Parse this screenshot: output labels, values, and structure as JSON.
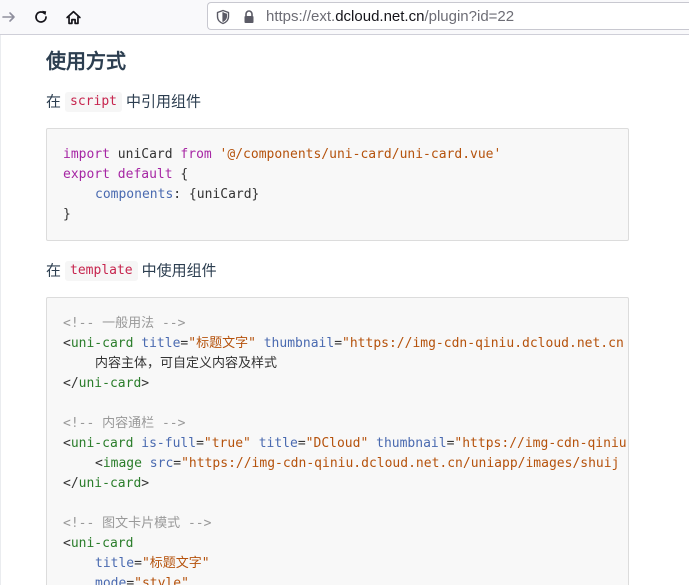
{
  "browser": {
    "url_scheme": "https://ext.",
    "url_host": "dcloud.net.cn",
    "url_path": "/plugin?id=22",
    "icons": [
      "arrow-right-icon",
      "reload-icon",
      "home-icon",
      "shield-icon",
      "lock-icon"
    ]
  },
  "page": {
    "section_title": "使用方式",
    "para1": {
      "prefix": "在",
      "code": "script",
      "suffix": "中引用组件"
    },
    "para2": {
      "prefix": "在",
      "code": "template",
      "suffix": "中使用组件"
    },
    "code1": {
      "l1_kw": "import",
      "l1_name": " uniCard ",
      "l1_from": "from",
      "l1_str": " '@/components/uni-card/uni-card.vue'",
      "l2_kw": "export",
      "l2_default": " default",
      "l2_brace": " {",
      "l3_prop": "components",
      "l3_rest": ": {uniCard}",
      "l4": "}"
    },
    "code2": {
      "c1": "<!-- 一般用法 -->",
      "l2_lt": "<",
      "l2_tag": "uni-card",
      "l2_a1": " title",
      "l2_eq1": "=",
      "l2_v1": "\"标题文字\"",
      "l2_a2": " thumbnail",
      "l2_eq2": "=",
      "l2_v2": "\"https://img-cdn-qiniu.dcloud.net.cn",
      "l3": "内容主体，可自定义内容及样式",
      "l4_lt": "</",
      "l4_tag": "uni-card",
      "l4_gt": ">",
      "c2": "<!-- 内容通栏 -->",
      "l6_lt": "<",
      "l6_tag": "uni-card",
      "l6_a1": " is-full",
      "l6_eq1": "=",
      "l6_v1": "\"true\"",
      "l6_a2": " title",
      "l6_eq2": "=",
      "l6_v2": "\"DCloud\"",
      "l6_a3": " thumbnail",
      "l6_eq3": "=",
      "l6_v3": "\"https://img-cdn-qiniu",
      "l7_lt": "<",
      "l7_tag": "image",
      "l7_a1": " src",
      "l7_eq1": "=",
      "l7_v1": "\"https://img-cdn-qiniu.dcloud.net.cn/uniapp/images/shuij",
      "l8_lt": "</",
      "l8_tag": "uni-card",
      "l8_gt": ">",
      "c3": "<!-- 图文卡片模式 -->",
      "l10_lt": "<",
      "l10_tag": "uni-card",
      "l11_a": "title",
      "l11_eq": "=",
      "l11_v": "\"标题文字\"",
      "l12_a": "mode",
      "l12_eq": "=",
      "l12_v": "\"style\""
    }
  },
  "colors": {
    "code_bg": "#f8f8f8",
    "keyword": "#a626a4",
    "string": "#b5520c",
    "comment": "#999999",
    "tag": "#2a7d2a",
    "attribute": "#4a6ab0",
    "inline_code": "#c7254e"
  }
}
